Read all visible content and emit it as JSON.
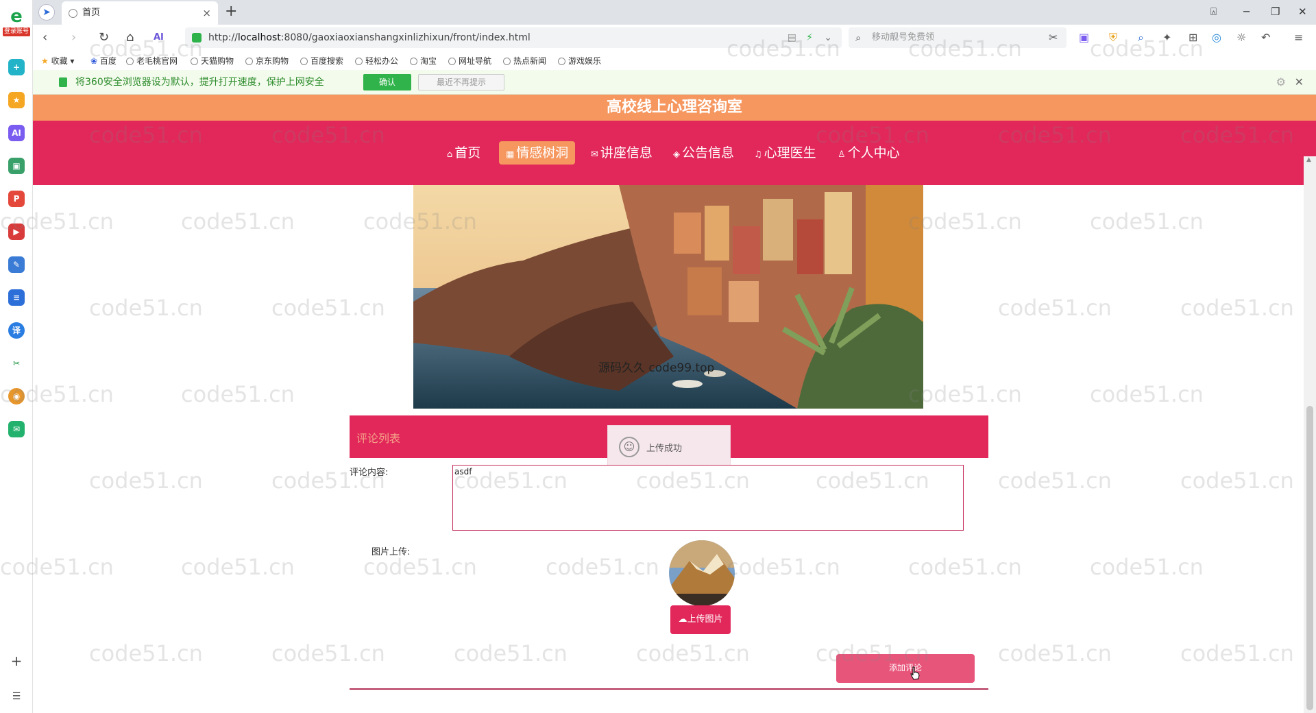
{
  "browser": {
    "sidebar_register_label": "登录账号",
    "tab_title": "首页",
    "url_prefix": "http://",
    "url_host": "localhost",
    "url_rest": ":8080/gaoxiaoxianshangxinlizhixun/front/index.html",
    "search_placeholder": "移动靓号免费领",
    "bookmarks": [
      "收藏",
      "百度",
      "老毛桃官网",
      "天猫购物",
      "京东购物",
      "百度搜索",
      "轻松办公",
      "淘宝",
      "网址导航",
      "热点新闻",
      "游戏娱乐"
    ],
    "notice": {
      "message": "将360安全浏览器设为默认，提升打开速度，保护上网安全",
      "confirm_label": "确认",
      "dismiss_label": "最近不再提示"
    }
  },
  "site": {
    "banner_title": "高校线上心理咨询室",
    "nav": [
      {
        "icon": "⌂",
        "label": "首页",
        "active": false
      },
      {
        "icon": "▦",
        "label": "情感树洞",
        "active": true
      },
      {
        "icon": "✉",
        "label": "讲座信息",
        "active": false
      },
      {
        "icon": "◈",
        "label": "公告信息",
        "active": false
      },
      {
        "icon": "♫",
        "label": "心理医生",
        "active": false
      },
      {
        "icon": "♙",
        "label": "个人中心",
        "active": false
      }
    ],
    "hero_watermark": "源码久久 code99.top"
  },
  "comments": {
    "section_title": "评论列表",
    "toast_message": "上传成功",
    "content_label": "评论内容:",
    "content_value": "asdf",
    "image_label": "图片上传:",
    "upload_button": "上传图片",
    "submit_button": "添加评论"
  },
  "watermark_text": "code51.cn",
  "colors": {
    "banner": "#f5975f",
    "nav": "#e2275a",
    "accent": "#e2275a",
    "active_nav": "#f5975f",
    "submit": "#e8557b"
  }
}
